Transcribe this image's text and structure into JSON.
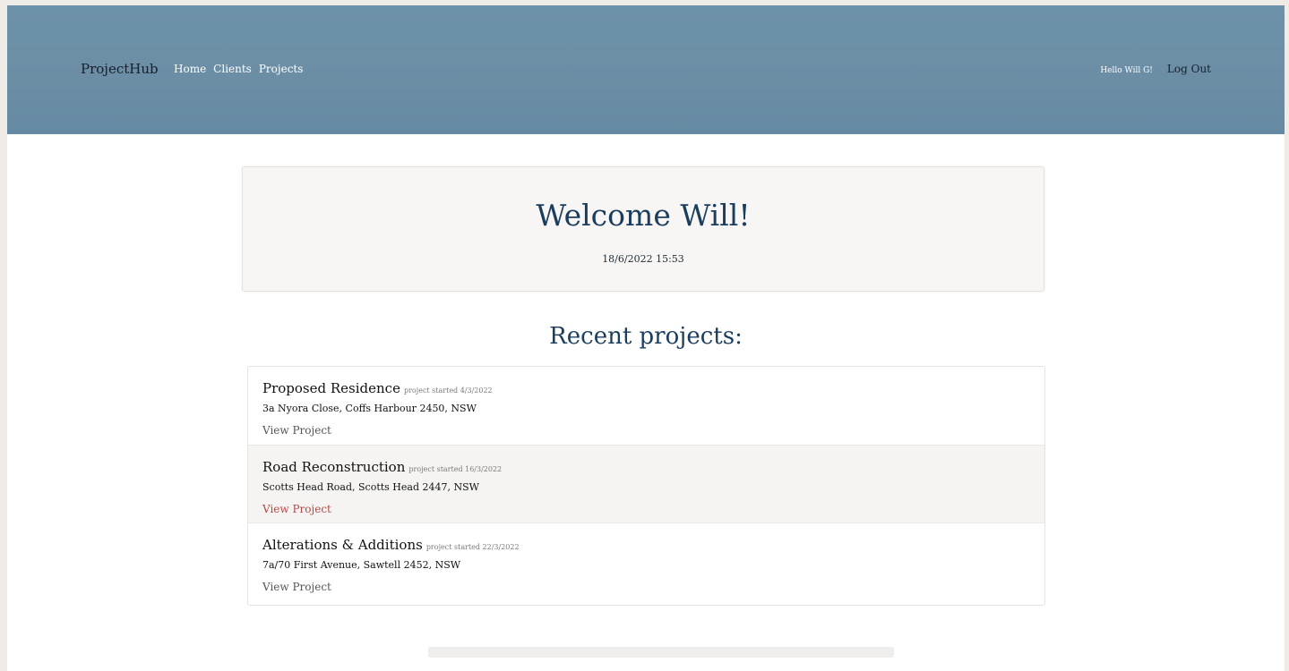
{
  "navbar": {
    "brand": "ProjectHub",
    "links": [
      "Home",
      "Clients",
      "Projects"
    ],
    "greeting": "Hello Will G!",
    "logout": "Log Out"
  },
  "welcome": {
    "title": "Welcome Will!",
    "datetime": "18/6/2022 15:53"
  },
  "recent": {
    "heading": "Recent projects:",
    "projects": [
      {
        "name": "Proposed Residence",
        "started": "project started 4/3/2022",
        "address": "3a Nyora Close, Coffs Harbour 2450, NSW",
        "link": "View Project"
      },
      {
        "name": "Road Reconstruction",
        "started": "project started 16/3/2022",
        "address": "Scotts Head Road, Scotts Head 2447, NSW",
        "link": "View Project"
      },
      {
        "name": "Alterations & Additions",
        "started": "project started 22/3/2022",
        "address": "7a/70 First Avenue, Sawtell 2452, NSW",
        "link": "View Project"
      }
    ]
  },
  "colors": {
    "navbar": "#6b8ea5",
    "heading": "#1b3d5e",
    "link_active": "#b04a4a"
  }
}
